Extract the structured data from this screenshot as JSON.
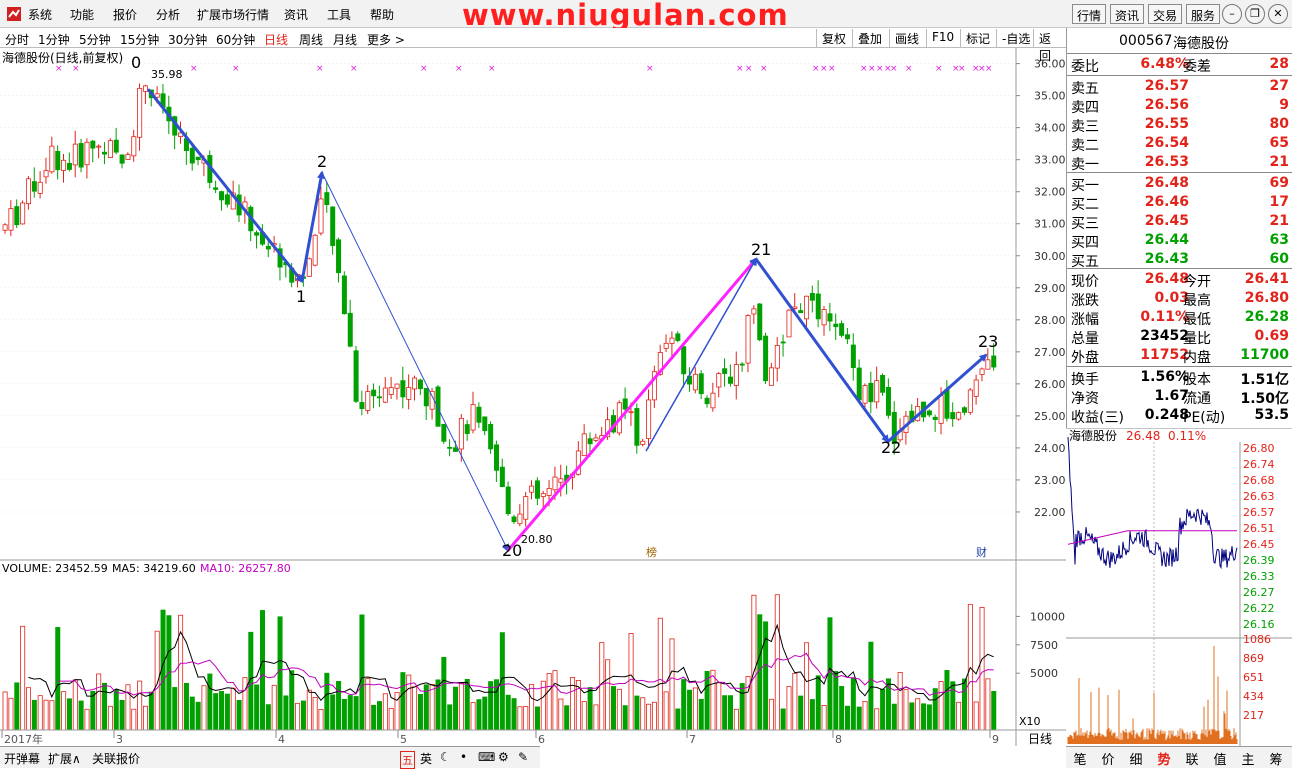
{
  "menu": [
    "系统",
    "功能",
    "报价",
    "分析",
    "扩展市场行情",
    "资讯",
    "工具",
    "帮助"
  ],
  "watermark": "www.niugulan.com",
  "top_buttons": [
    "行情",
    "资讯",
    "交易",
    "服务"
  ],
  "window_buttons": [
    "minimize-icon",
    "restore-icon",
    "close-icon"
  ],
  "periods": [
    "分时",
    "1分钟",
    "5分钟",
    "15分钟",
    "30分钟",
    "60分钟",
    "日线",
    "周线",
    "月线",
    "更多 >"
  ],
  "period_active": "日线",
  "toolbar": [
    "复权",
    "叠加",
    "画线",
    "F10",
    "标记",
    "-自选",
    "返回"
  ],
  "chart_title": "海德股份(日线,前复权)",
  "price_axis": [
    "36.00",
    "35.00",
    "34.00",
    "33.00",
    "32.00",
    "31.00",
    "30.00",
    "29.00",
    "28.00",
    "27.00",
    "26.00",
    "25.00",
    "24.00",
    "23.00",
    "22.00"
  ],
  "high_label": "35.98",
  "low_label": "20.80",
  "wave_labels": [
    "0",
    "1",
    "2",
    "20",
    "21",
    "22",
    "23"
  ],
  "volume_header": {
    "volume": "VOLUME: 23452.59",
    "ma5": "MA5: 34219.60",
    "ma10": "MA10: 26257.80"
  },
  "volume_axis": [
    "10000",
    "7500",
    "5000"
  ],
  "volume_unit": "X10",
  "date_axis": [
    "2017年",
    "3",
    "4",
    "5",
    "6",
    "7",
    "8",
    "9"
  ],
  "period_label": "日线",
  "markers": [
    "榜",
    "财"
  ],
  "quote": {
    "code": "000567",
    "name": "海德股份",
    "weibi_label": "委比",
    "weibi": "6.48%",
    "weicha_label": "委差",
    "weicha": "28",
    "asks": [
      {
        "label": "卖五",
        "price": "26.57",
        "vol": "27"
      },
      {
        "label": "卖四",
        "price": "26.56",
        "vol": "9"
      },
      {
        "label": "卖三",
        "price": "26.55",
        "vol": "80"
      },
      {
        "label": "卖二",
        "price": "26.54",
        "vol": "65"
      },
      {
        "label": "卖一",
        "price": "26.53",
        "vol": "21"
      }
    ],
    "bids": [
      {
        "label": "买一",
        "price": "26.48",
        "vol": "69"
      },
      {
        "label": "买二",
        "price": "26.46",
        "vol": "17"
      },
      {
        "label": "买三",
        "price": "26.45",
        "vol": "21"
      },
      {
        "label": "买四",
        "price": "26.44",
        "vol": "63"
      },
      {
        "label": "买五",
        "price": "26.43",
        "vol": "60"
      }
    ],
    "stats": [
      {
        "l1": "现价",
        "v1": "26.48",
        "l2": "今开",
        "v2": "26.41"
      },
      {
        "l1": "涨跌",
        "v1": "0.03",
        "l2": "最高",
        "v2": "26.80"
      },
      {
        "l1": "涨幅",
        "v1": "0.11%",
        "l2": "最低",
        "v2": "26.28"
      },
      {
        "l1": "总量",
        "v1": "23452",
        "l2": "量比",
        "v2": "0.69"
      },
      {
        "l1": "外盘",
        "v1": "11752",
        "l2": "内盘",
        "v2": "11700"
      }
    ],
    "stats2": [
      {
        "l1": "换手",
        "v1": "1.56%",
        "l2": "股本",
        "v2": "1.51亿"
      },
      {
        "l1": "净资",
        "v1": "1.67",
        "l2": "流通",
        "v2": "1.50亿"
      },
      {
        "l1": "收益(三)",
        "v1": "0.248",
        "l2": "PE(动)",
        "v2": "53.5"
      }
    ]
  },
  "mini_chart": {
    "title": "海德股份",
    "price": "26.48",
    "pct": "0.11%",
    "price_axis": [
      "26.80",
      "26.74",
      "26.68",
      "26.63",
      "26.57",
      "26.51",
      "26.45",
      "26.39",
      "26.33",
      "26.27",
      "26.22",
      "26.16"
    ],
    "vol_axis": [
      "1086",
      "869",
      "651",
      "434",
      "217"
    ]
  },
  "bottom_left": [
    "开弹幕",
    "扩展∧",
    "关联报价"
  ],
  "bottom_tabs": [
    "笔",
    "价",
    "细",
    "势",
    "联",
    "值",
    "主",
    "筹"
  ],
  "bottom_tab_active": "势",
  "colors": {
    "up": "#e2231a",
    "down": "#00a000",
    "ma5": "#000000",
    "ma10": "#c000c0",
    "wave": "#3050d0",
    "wave_highlight": "#ff20ff"
  },
  "chart_data": {
    "type": "candlestick",
    "title": "海德股份(日线,前复权)",
    "ylim": [
      20.5,
      36.3
    ],
    "waves": [
      {
        "label": "0",
        "price": 35.98
      },
      {
        "label": "1",
        "price": 29.2
      },
      {
        "label": "2",
        "price": 32.6
      },
      {
        "label": "20",
        "price": 20.8
      },
      {
        "label": "21",
        "price": 29.9
      },
      {
        "label": "22",
        "price": 24.2
      },
      {
        "label": "23",
        "price": 26.9
      }
    ]
  }
}
